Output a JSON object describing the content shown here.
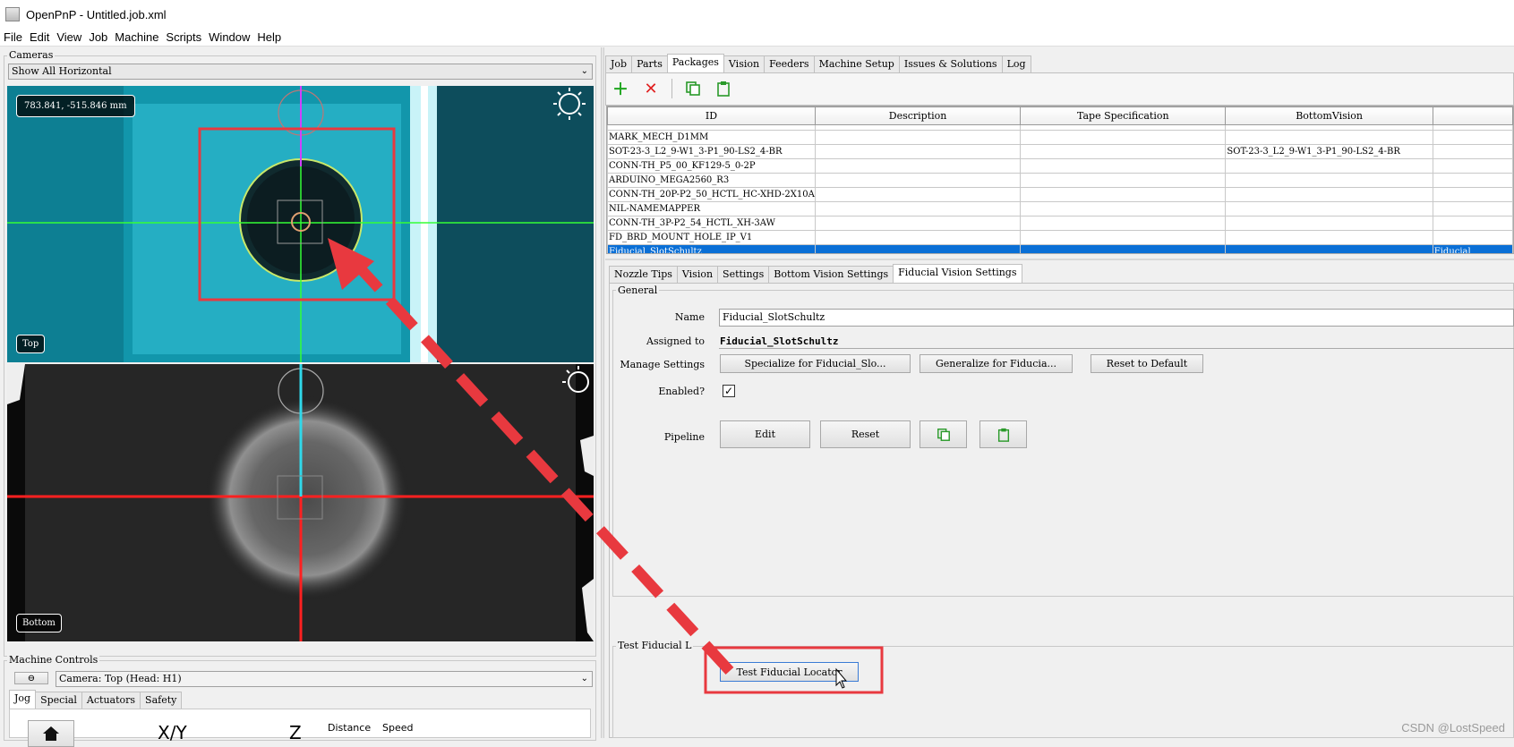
{
  "window": {
    "title": "OpenPnP - Untitled.job.xml"
  },
  "menu": [
    "File",
    "Edit",
    "View",
    "Job",
    "Machine",
    "Scripts",
    "Window",
    "Help"
  ],
  "cameras": {
    "legend": "Cameras",
    "layout_select": "Show All Horizontal",
    "top": {
      "label": "Top",
      "coordinates": "783.841, -515.846 mm"
    },
    "bottom": {
      "label": "Bottom"
    }
  },
  "machine_controls": {
    "legend": "Machine Controls",
    "collapse_symbol": "⊖",
    "camera_select": "Camera: Top (Head: H1)",
    "tabs": [
      "Jog",
      "Special",
      "Actuators",
      "Safety"
    ],
    "active_tab": "Jog",
    "jog_labels": {
      "xy": "X/Y",
      "z": "Z",
      "distance": "Distance",
      "speed": "Speed"
    }
  },
  "main_tabs": [
    "Job",
    "Parts",
    "Packages",
    "Vision",
    "Feeders",
    "Machine Setup",
    "Issues & Solutions",
    "Log"
  ],
  "active_main_tab": "Packages",
  "toolbar_icons": [
    "plus-icon",
    "delete-x-icon",
    "copy-icon",
    "paste-icon"
  ],
  "colors": {
    "selection": "#0a6fd6",
    "add_green": "#1fa51f",
    "delete_red": "#e02020",
    "annotation_red": "#e8393f"
  },
  "packages_table": {
    "columns": [
      "ID",
      "Description",
      "Tape Specification",
      "BottomVision"
    ],
    "rows": [
      {
        "id": "MARK_MECH_D1MM",
        "description": "",
        "tape": "",
        "bottom_vision": ""
      },
      {
        "id": "SOT-23-3_L2_9-W1_3-P1_90-LS2_4-BR",
        "description": "",
        "tape": "",
        "bottom_vision": "SOT-23-3_L2_9-W1_3-P1_90-LS2_4-BR"
      },
      {
        "id": "CONN-TH_P5_00_KF129-5_0-2P",
        "description": "",
        "tape": "",
        "bottom_vision": ""
      },
      {
        "id": "ARDUINO_MEGA2560_R3",
        "description": "",
        "tape": "",
        "bottom_vision": ""
      },
      {
        "id": "CONN-TH_20P-P2_50_HCTL_HC-XHD-2X10A",
        "description": "",
        "tape": "",
        "bottom_vision": ""
      },
      {
        "id": "NIL-NAMEMAPPER",
        "description": "",
        "tape": "",
        "bottom_vision": ""
      },
      {
        "id": "CONN-TH_3P-P2_54_HCTL_XH-3AW",
        "description": "",
        "tape": "",
        "bottom_vision": ""
      },
      {
        "id": "FD_BRD_MOUNT_HOLE_IP_V1",
        "description": "",
        "tape": "",
        "bottom_vision": ""
      },
      {
        "id": "Fiducial_SlotSchultz",
        "description": "",
        "tape": "",
        "bottom_vision": "",
        "extra": "Fiducial"
      }
    ],
    "selected_index": 8
  },
  "detail_tabs": [
    "Nozzle Tips",
    "Vision",
    "Settings",
    "Bottom Vision Settings",
    "Fiducial Vision Settings"
  ],
  "active_detail_tab": "Fiducial Vision Settings",
  "fiducial_settings": {
    "general_legend": "General",
    "name_label": "Name",
    "name_value": "Fiducial_SlotSchultz",
    "assigned_label": "Assigned to",
    "assigned_value": "Fiducial_SlotSchultz",
    "manage_label": "Manage Settings",
    "specialize_button": "Specialize for Fiducial_Slo...",
    "generalize_button": "Generalize for Fiducia...",
    "reset_default_button": "Reset to Default",
    "enabled_label": "Enabled?",
    "enabled": true,
    "pipeline_label": "Pipeline",
    "edit_button": "Edit",
    "reset_button": "Reset",
    "test_legend": "Test Fiducial L",
    "test_button": "Test Fiducial Locator"
  },
  "watermark": "CSDN @LostSpeed"
}
